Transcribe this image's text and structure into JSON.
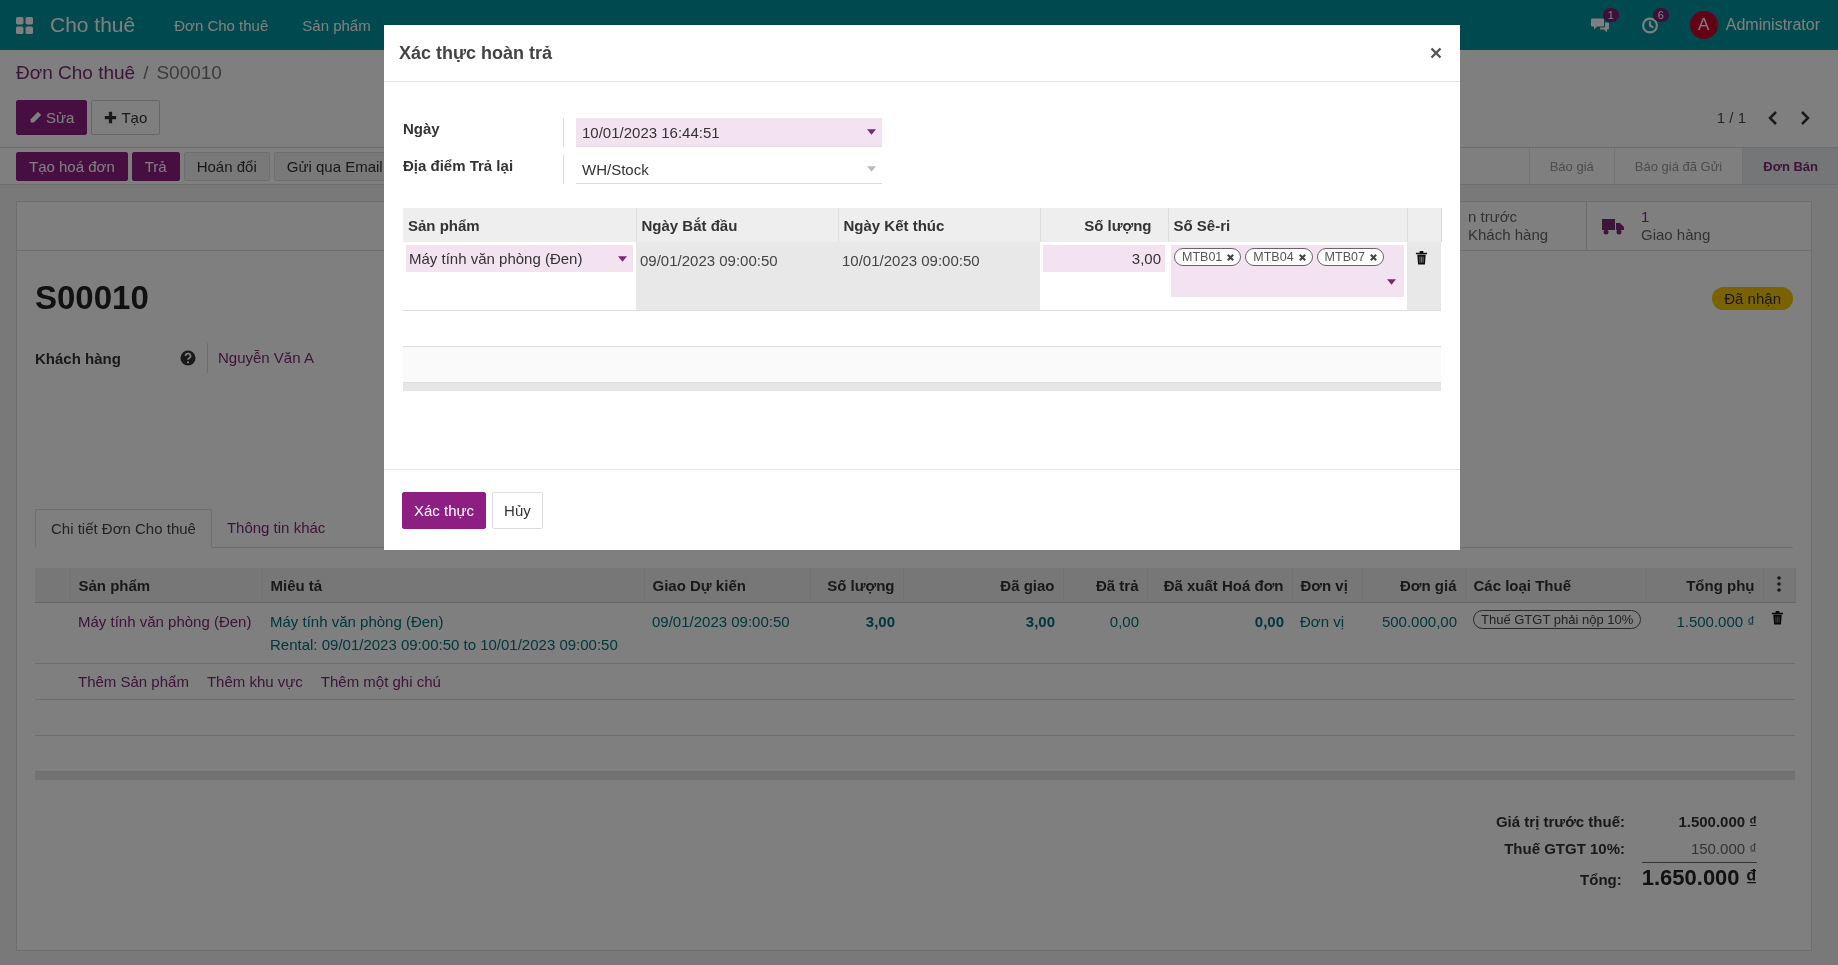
{
  "navbar": {
    "app_name": "Cho thuê",
    "menu": [
      {
        "label": "Đơn Cho thuê"
      },
      {
        "label": "Sản phẩm"
      }
    ],
    "messages_count": "1",
    "activities_count": "6",
    "user_initial": "A",
    "user_name": "Administrator"
  },
  "breadcrumb": {
    "parent": "Đơn Cho thuê",
    "separator": "/",
    "current": "S00010"
  },
  "actions": [
    {
      "label": "Sửa",
      "kind": "edit"
    },
    {
      "label": "Tạo",
      "kind": "create"
    }
  ],
  "pager": "1 / 1",
  "header_buttons": [
    {
      "label": "Tạo hoá đơn",
      "kind": "primary"
    },
    {
      "label": "Trả",
      "kind": "primary"
    },
    {
      "label": "Hoán đổi",
      "kind": "secondary"
    },
    {
      "label": "Gửi qua Email",
      "kind": "secondary"
    }
  ],
  "status_stages": [
    {
      "label": "Báo giá",
      "selected": false
    },
    {
      "label": "Báo giá đã Gửi",
      "selected": false
    },
    {
      "label": "Đơn Bán",
      "selected": true
    }
  ],
  "stat_buttons": [
    {
      "kind": "plain",
      "title": "n trước",
      "subtitle": "Khách hàng"
    },
    {
      "kind": "delivery",
      "title": "1",
      "subtitle": "Giao hàng"
    }
  ],
  "record": {
    "name": "S00010",
    "state_badge": "Đã nhận",
    "customer_label": "Khách hàng",
    "customer": "Nguyễn Văn A"
  },
  "tabs": [
    {
      "label": "Chi tiết Đơn Cho thuê",
      "selected": true
    },
    {
      "label": "Thông tin khác",
      "selected": false
    }
  ],
  "order_lines": {
    "columns": [
      {
        "label": "Sản phẩm"
      },
      {
        "label": "Miêu tả"
      },
      {
        "label": "Giao Dự kiến"
      },
      {
        "label": "Số lượng"
      },
      {
        "label": "Đã giao"
      },
      {
        "label": "Đã trả"
      },
      {
        "label": "Đã xuất Hoá đơn"
      },
      {
        "label": "Đơn vị"
      },
      {
        "label": "Đơn giá"
      },
      {
        "label": "Các loại Thuế"
      },
      {
        "label": "Tổng phụ"
      }
    ],
    "rows": [
      {
        "cells": [
          {
            "kind": "product",
            "lines": [
              "Máy tính văn phòng (Đen)"
            ]
          },
          {
            "kind": "link",
            "lines": [
              "Máy tính văn phòng (Đen)",
              "Rental: 09/01/2023 09:00:50 to 10/01/2023 09:00:50"
            ]
          },
          {
            "kind": "link",
            "lines": [
              "09/01/2023 09:00:50"
            ]
          },
          {
            "kind": "number_bold",
            "lines": [
              "3,00"
            ]
          },
          {
            "kind": "number_bold",
            "lines": [
              "3,00"
            ]
          },
          {
            "kind": "number",
            "lines": [
              "0,00"
            ]
          },
          {
            "kind": "number_bold",
            "lines": [
              "0,00"
            ]
          },
          {
            "kind": "link",
            "lines": [
              "Đơn vị"
            ]
          },
          {
            "kind": "number",
            "lines": [
              "500.000,00"
            ]
          },
          {
            "kind": "tag",
            "lines": [
              "Thuế GTGT phải nộp 10%"
            ]
          },
          {
            "kind": "number",
            "lines": [
              "1.500.000 ₫"
            ]
          }
        ]
      }
    ],
    "add_links": [
      "Thêm Sản phẩm",
      "Thêm khu vực",
      "Thêm một ghi chú"
    ]
  },
  "totals": [
    {
      "kind": "subtotal",
      "label": "Giá trị trước thuế:",
      "value": "1.500.000 ₫"
    },
    {
      "kind": "tax",
      "label": "Thuế GTGT 10%:",
      "value": "150.000 ₫"
    },
    {
      "kind": "total",
      "label": "Tổng:",
      "value": "1.650.000 ₫"
    }
  ],
  "dialog": {
    "title": "Xác thực hoàn trả",
    "fields": [
      {
        "label": "Ngày",
        "value": "10/01/2023 16:44:51",
        "required": true
      },
      {
        "label": "Địa điểm Trả lại",
        "value": "WH/Stock",
        "required": false
      }
    ],
    "lines": {
      "columns": [
        {
          "label": "Sản phẩm"
        },
        {
          "label": "Ngày Bắt đầu"
        },
        {
          "label": "Ngày Kết thúc"
        },
        {
          "label": "Số lượng"
        },
        {
          "label": "Số Sê-ri"
        }
      ],
      "rows": [
        {
          "product": "Máy tính văn phòng (Đen)",
          "start": "09/01/2023 09:00:50",
          "end": "10/01/2023 09:00:50",
          "quantity": "3,00",
          "serials": [
            "MTB01",
            "MTB04",
            "MTB07"
          ]
        }
      ]
    },
    "buttons": [
      {
        "label": "Xác thực",
        "kind": "primary"
      },
      {
        "label": "Hủy",
        "kind": "secondary"
      }
    ]
  }
}
